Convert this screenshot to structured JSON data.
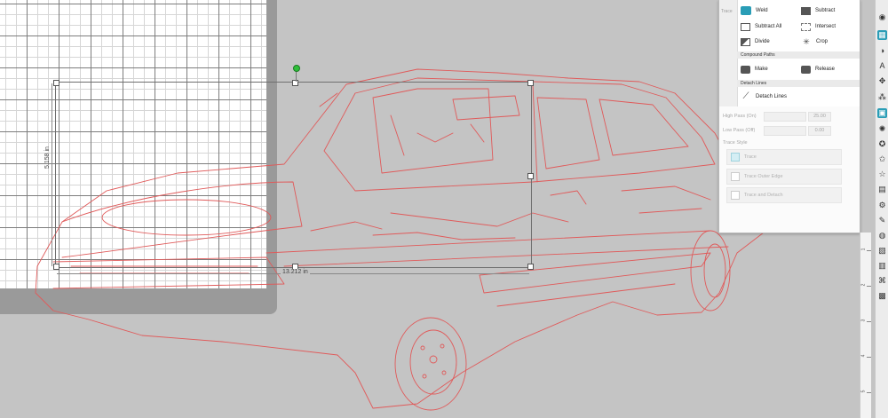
{
  "canvas": {
    "selection_width_label": "13.212 in",
    "selection_height_label": "5.158 in",
    "colors": {
      "trace": "#e05a5a",
      "accent": "#2a9db6",
      "rotate_handle": "#2fbf3a"
    }
  },
  "modify_panel": {
    "row1": {
      "weld": "Weld",
      "subtract": "Subtract"
    },
    "row2": {
      "subtract_all": "Subtract All",
      "intersect": "Intersect"
    },
    "row3": {
      "divide": "Divide",
      "crop": "Crop"
    },
    "compound_paths": {
      "header": "Compound Paths",
      "make": "Make",
      "release": "Release"
    },
    "detach_lines": {
      "header": "Detach Lines",
      "button": "Detach Lines"
    }
  },
  "trace_panel": {
    "high_pass_label": "High Pass (On)",
    "high_pass_value": "25.00",
    "low_pass_label": "Low Pass (Off)",
    "low_pass_value": "0.00",
    "trace_style_header": "Trace Style",
    "trace_button": "Trace",
    "trace_outer_edge_button": "Trace Outer Edge",
    "trace_and_detach_button": "Trace and Detach"
  },
  "ruler": {
    "labels": [
      "1",
      "2",
      "3",
      "4",
      "5"
    ]
  },
  "icons": {
    "toolbar": [
      "shapes-icon",
      "grid-icon",
      "fill-icon",
      "text-icon",
      "transform-icon",
      "replicate-icon",
      "modify-icon",
      "star-icon",
      "library-icon",
      "offset-icon",
      "star-outline-icon",
      "layers-icon",
      "gear-icon",
      "sketch-icon",
      "globe-icon",
      "book-icon",
      "page-icon",
      "ab-icon",
      "pattern-icon"
    ]
  }
}
